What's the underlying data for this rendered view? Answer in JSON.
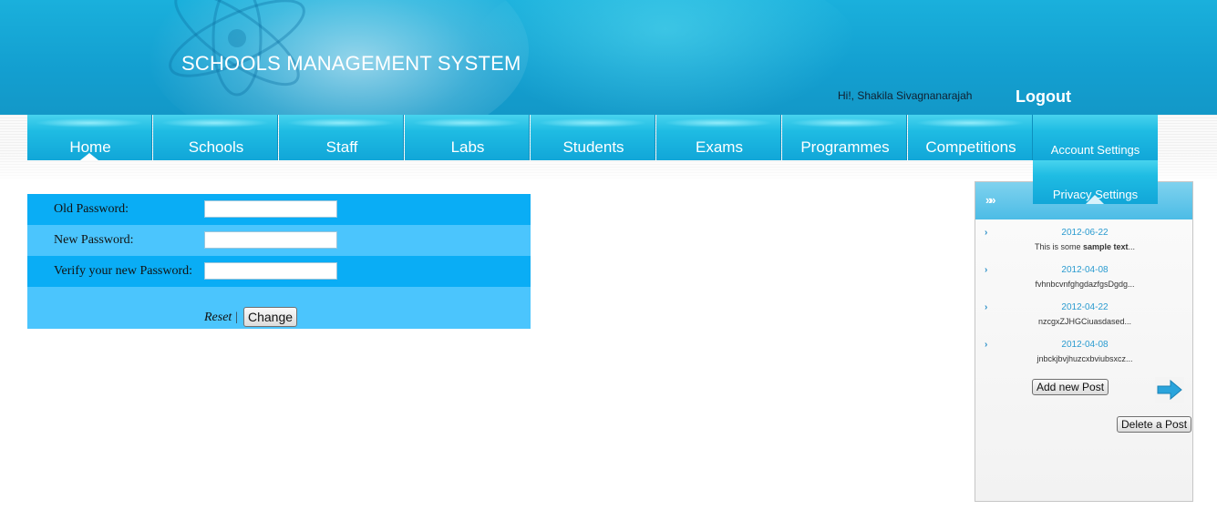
{
  "header": {
    "title": "SCHOOLS MANAGEMENT SYSTEM",
    "greeting": "Hi!, Shakila Sivagnanarajah",
    "logout": "Logout"
  },
  "nav": {
    "items": [
      {
        "label": "Home"
      },
      {
        "label": "Schools"
      },
      {
        "label": "Staff"
      },
      {
        "label": "Labs"
      },
      {
        "label": "Students"
      },
      {
        "label": "Exams"
      },
      {
        "label": "Programmes"
      },
      {
        "label": "Competitions"
      }
    ],
    "dropdown": [
      {
        "label": "Account Settings"
      },
      {
        "label": "Privacy Settings"
      }
    ]
  },
  "password_form": {
    "old_label": "Old Password:",
    "old_value": "",
    "new_label": "New Password:",
    "new_value": "",
    "verify_label": "Verify your new Password:",
    "verify_value": "",
    "reset": "Reset",
    "separator": "|",
    "change": "Change"
  },
  "sidebar": {
    "posts": [
      {
        "date": "2012-06-22",
        "excerpt_pre": "This is some ",
        "excerpt_bold": "sample text",
        "excerpt_post": "..."
      },
      {
        "date": "2012-04-08",
        "excerpt_pre": "fvhnbcvnfghgdazfgsDgdg...",
        "excerpt_bold": "",
        "excerpt_post": ""
      },
      {
        "date": "2012-04-22",
        "excerpt_pre": "nzcgxZJHGCiuasdased...",
        "excerpt_bold": "",
        "excerpt_post": ""
      },
      {
        "date": "2012-04-08",
        "excerpt_pre": "jnbckjbvjhuzcxbviubsxcz...",
        "excerpt_bold": "",
        "excerpt_post": ""
      }
    ],
    "add_post": "Add new Post",
    "delete_post": "Delete a Post"
  },
  "colors": {
    "header": "#139fd0",
    "nav": "#1fbce3",
    "form_dark": "#0aadf5",
    "form_light": "#4bc5fd"
  }
}
